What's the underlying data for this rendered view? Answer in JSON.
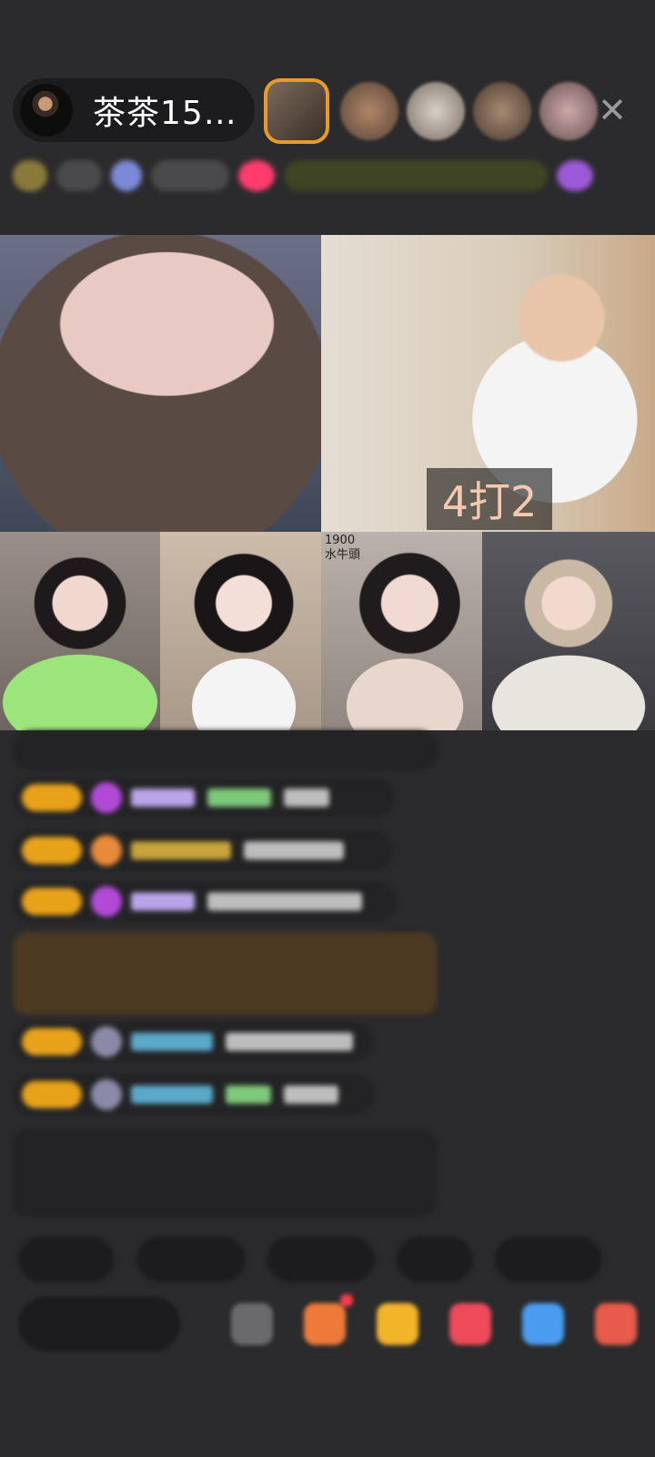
{
  "header": {
    "host_name": "茶茶15…",
    "close_label": "✕"
  },
  "video": {
    "score_label": "4打2",
    "watermark_line1": "1900",
    "watermark_line2": "水牛頭"
  },
  "colors": {
    "background": "#2b2b2d",
    "pill": "#1c1c1e",
    "level_badge": "#e8a21a",
    "gift_message": "#4d3a22",
    "viewer_highlight": "#e89a2a"
  },
  "icons": {
    "close": "close-icon",
    "gift": "gift-icon",
    "more": "more-icon"
  }
}
